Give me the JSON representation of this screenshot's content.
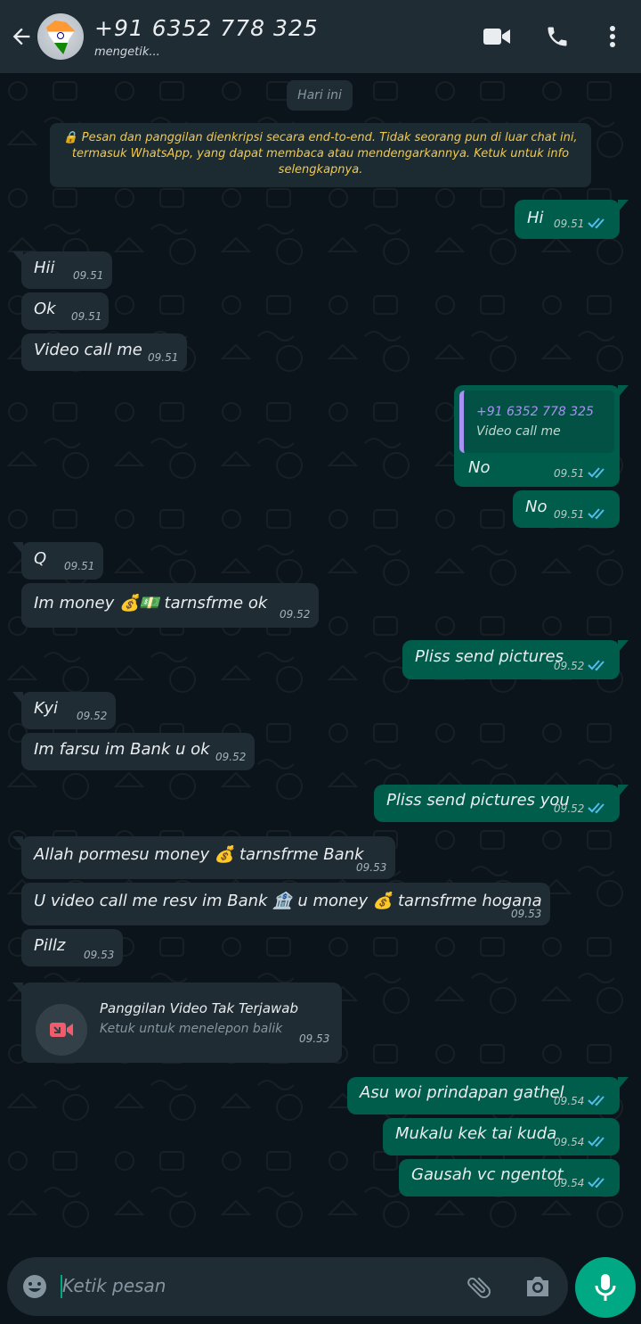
{
  "header": {
    "title": "+91 6352 778 325",
    "status": "mengetik...",
    "icons": [
      "back-arrow-icon",
      "video-call-icon",
      "phone-icon",
      "more-vert-icon"
    ]
  },
  "chat": {
    "day_label": "Hari ini",
    "encryption_notice": "🔒 Pesan dan panggilan dienkripsi secara end-to-end. Tidak seorang pun di luar chat ini, termasuk WhatsApp, yang dapat membaca atau mendengarkannya. Ketuk untuk info selengkapnya.",
    "messages": [
      {
        "dir": "out",
        "text": "Hi",
        "time": "09.51",
        "read": true
      },
      {
        "dir": "in",
        "text": "Hii",
        "time": "09.51"
      },
      {
        "dir": "in",
        "text": "Ok",
        "time": "09.51"
      },
      {
        "dir": "in",
        "text": "Video call me",
        "time": "09.51"
      },
      {
        "dir": "out",
        "quote_name": "+91 6352 778 325",
        "quote_text": "Video call me",
        "text": "No",
        "time": "09.51",
        "read": true
      },
      {
        "dir": "out",
        "text": "No",
        "time": "09.51",
        "read": true
      },
      {
        "dir": "in",
        "text": "Q",
        "time": "09.51"
      },
      {
        "dir": "in",
        "text": "Im money 💰💵 tarnsfrme ok",
        "time": "09.52"
      },
      {
        "dir": "out",
        "text": "Pliss send pictures",
        "time": "09.52",
        "read": true
      },
      {
        "dir": "in",
        "text": "Kyi",
        "time": "09.52"
      },
      {
        "dir": "in",
        "text": "Im farsu im Bank u ok",
        "time": "09.52"
      },
      {
        "dir": "out",
        "text": "Pliss send pictures you",
        "time": "09.52",
        "read": true
      },
      {
        "dir": "in",
        "text": "Allah pormesu money 💰 tarnsfrme Bank",
        "time": "09.53"
      },
      {
        "dir": "in",
        "text": "U video call me resv im Bank 🏦 u money 💰 tarnsfrme hogana",
        "time": "09.53"
      },
      {
        "dir": "in",
        "text": "Pillz",
        "time": "09.53"
      },
      {
        "dir": "in",
        "type": "missed-call",
        "title": "Panggilan Video Tak Terjawab",
        "subtitle": "Ketuk untuk menelepon balik",
        "time": "09.53"
      },
      {
        "dir": "out",
        "text": "Asu woi prindapan gathel",
        "time": "09.54",
        "read": true
      },
      {
        "dir": "out",
        "text": "Mukalu kek tai kuda",
        "time": "09.54",
        "read": true
      },
      {
        "dir": "out",
        "text": "Gausah vc ngentot",
        "time": "09.54",
        "read": true
      }
    ]
  },
  "composer": {
    "placeholder": "Ketik pesan",
    "icons": [
      "emoji-icon",
      "attach-icon",
      "camera-icon",
      "mic-icon"
    ]
  },
  "colors": {
    "header_bg": "#1f2c34",
    "chat_bg": "#0b141a",
    "incoming_bubble": "#1f2c34",
    "outgoing_bubble": "#005c4b",
    "accent": "#00a884",
    "read_tick": "#53bdeb"
  }
}
